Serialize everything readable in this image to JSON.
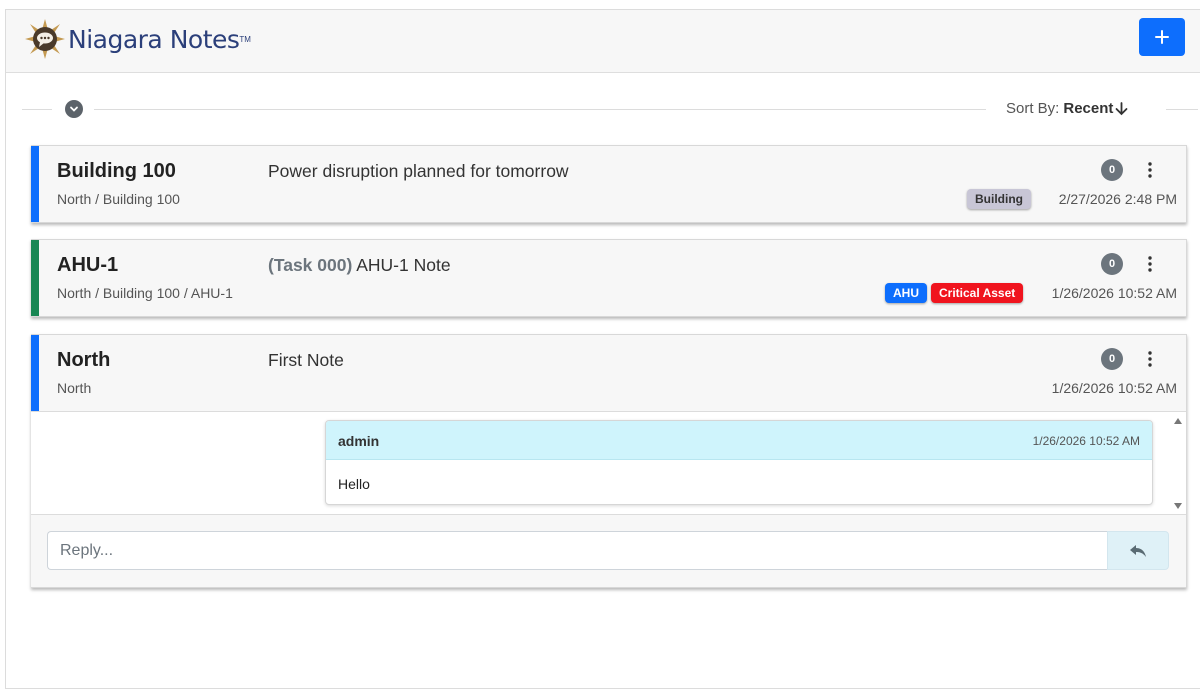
{
  "app": {
    "logo_text": "Niagara Notes",
    "logo_tm": "TM",
    "add_button_label": "+"
  },
  "toolbar": {
    "sort_label": "Sort By:",
    "sort_value": "Recent"
  },
  "notes": [
    {
      "title": "Building 100",
      "path": "North / Building 100",
      "task": "",
      "subject": "Power disruption planned for tomorrow",
      "count": "0",
      "tags": [
        {
          "label": "Building",
          "bg": "#c8c6d6",
          "color": "#333333"
        }
      ],
      "date": "2/27/2026 2:48 PM",
      "accent": "#0d6efd"
    },
    {
      "title": "AHU-1",
      "path": "North / Building 100 / AHU-1",
      "task": "(Task 000)",
      "subject": "AHU-1 Note",
      "count": "0",
      "tags": [
        {
          "label": "AHU",
          "bg": "#0d6efd",
          "color": "#ffffff"
        },
        {
          "label": "Critical Asset",
          "bg": "#f0141e",
          "color": "#ffffff"
        }
      ],
      "date": "1/26/2026 10:52 AM",
      "accent": "#198754"
    },
    {
      "title": "North",
      "path": "North",
      "task": "",
      "subject": "First Note",
      "count": "0",
      "tags": [],
      "date": "1/26/2026 10:52 AM",
      "accent": "#0d6efd",
      "messages": [
        {
          "author": "admin",
          "time": "1/26/2026 10:52 AM",
          "body": "Hello"
        }
      ],
      "reply_placeholder": "Reply..."
    }
  ]
}
